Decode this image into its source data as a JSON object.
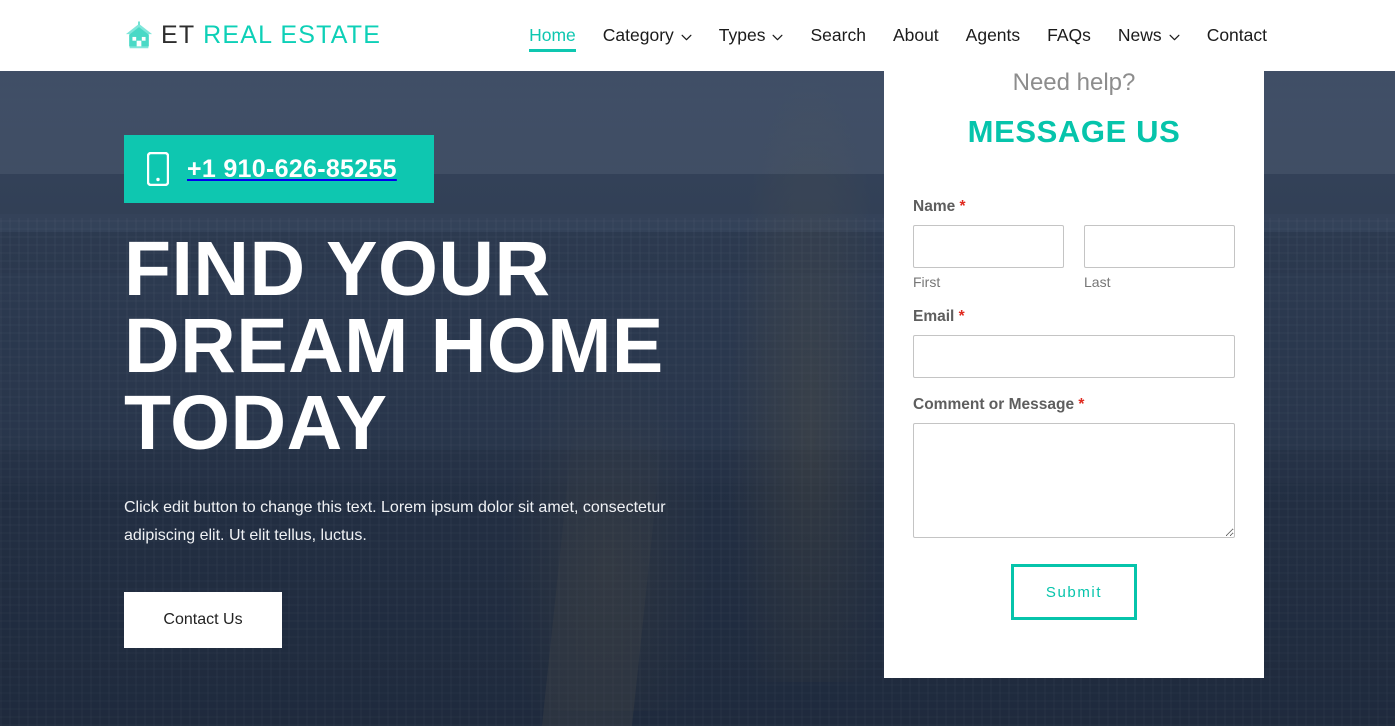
{
  "colors": {
    "accent_teal": "#0ec7b0",
    "accent_teal_dark": "#06c4ab",
    "required_red": "#e02b20",
    "header_bg": "#ffffff",
    "panel_bg": "#ffffff",
    "hero_text": "#ffffff"
  },
  "header": {
    "logo": {
      "icon": "house-icon",
      "text_dark": "ET",
      "text_accent": "REAL ESTATE"
    },
    "nav": [
      {
        "label": "Home",
        "active": true,
        "has_dropdown": false,
        "icon": ""
      },
      {
        "label": "Category",
        "active": false,
        "has_dropdown": true,
        "icon": "chevron-down-icon"
      },
      {
        "label": "Types",
        "active": false,
        "has_dropdown": true,
        "icon": "chevron-down-icon"
      },
      {
        "label": "Search",
        "active": false,
        "has_dropdown": false,
        "icon": ""
      },
      {
        "label": "About",
        "active": false,
        "has_dropdown": false,
        "icon": ""
      },
      {
        "label": "Agents",
        "active": false,
        "has_dropdown": false,
        "icon": ""
      },
      {
        "label": "FAQs",
        "active": false,
        "has_dropdown": false,
        "icon": ""
      },
      {
        "label": "News",
        "active": false,
        "has_dropdown": true,
        "icon": "chevron-down-icon"
      },
      {
        "label": "Contact",
        "active": false,
        "has_dropdown": false,
        "icon": ""
      }
    ]
  },
  "hero": {
    "phone_icon": "mobile-phone-icon",
    "phone_number": "+1 910-626-85255",
    "title": "Find Your Dream Home Today",
    "subtitle": "Click edit button to change this text. Lorem ipsum dolor sit amet, consectetur adipiscing elit. Ut elit tellus, luctus.",
    "cta_label": "Contact Us"
  },
  "form": {
    "eyebrow": "Need help?",
    "title": "Message Us",
    "name": {
      "label": "Name",
      "required": "*",
      "first": {
        "value": "",
        "placeholder": "",
        "sublabel": "First"
      },
      "last": {
        "value": "",
        "placeholder": "",
        "sublabel": "Last"
      }
    },
    "email": {
      "label": "Email",
      "required": "*",
      "value": "",
      "placeholder": ""
    },
    "message": {
      "label": "Comment or Message",
      "required": "*",
      "value": "",
      "placeholder": ""
    },
    "submit_label": "Submit"
  }
}
